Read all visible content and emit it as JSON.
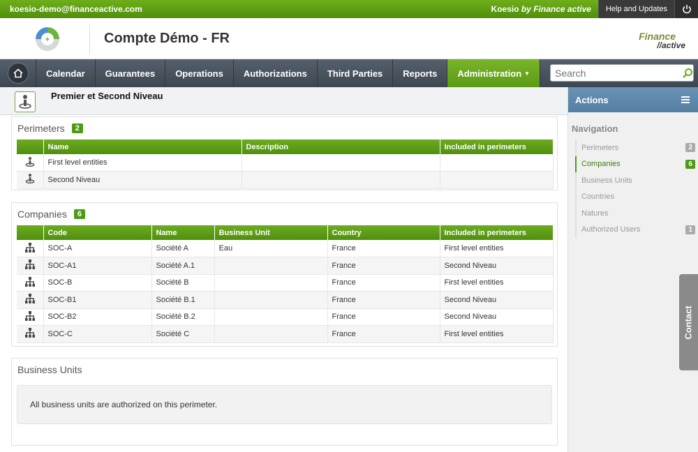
{
  "topbar": {
    "email": "koesio-demo@financeactive.com",
    "brand_prefix": "Koesio",
    "brand_suffix": "by Finance active",
    "help": "Help and Updates"
  },
  "header": {
    "title": "Compte Démo - FR",
    "logo_line1": "Finance",
    "logo_line2": "//active"
  },
  "nav": {
    "items": [
      "Calendar",
      "Guarantees",
      "Operations",
      "Authorizations",
      "Third Parties",
      "Reports"
    ],
    "active": "Administration",
    "search_placeholder": "Search"
  },
  "page": {
    "title": "Premier et Second Niveau"
  },
  "perimeters": {
    "title": "Perimeters",
    "count": "2",
    "columns": [
      "Name",
      "Description",
      "Included in perimeters"
    ],
    "rows": [
      [
        "First level entities",
        "",
        ""
      ],
      [
        "Second Niveau",
        "",
        ""
      ]
    ]
  },
  "companies": {
    "title": "Companies",
    "count": "6",
    "columns": [
      "Code",
      "Name",
      "Business Unit",
      "Country",
      "Included in perimeters"
    ],
    "rows": [
      [
        "SOC-A",
        "Société A",
        "Eau",
        "France",
        "First level entities"
      ],
      [
        "SOC-A1",
        "Société A.1",
        "",
        "France",
        "Second Niveau"
      ],
      [
        "SOC-B",
        "Société B",
        "",
        "France",
        "First level entities"
      ],
      [
        "SOC-B1",
        "Société B.1",
        "",
        "France",
        "Second Niveau"
      ],
      [
        "SOC-B2",
        "Société B.2",
        "",
        "France",
        "Second Niveau"
      ],
      [
        "SOC-C",
        "Société C",
        "",
        "France",
        "First level entities"
      ]
    ]
  },
  "business_units": {
    "title": "Business Units",
    "message": "All business units are authorized on this perimeter."
  },
  "sidebar": {
    "actions": "Actions",
    "navigation": "Navigation",
    "items": [
      {
        "label": "Perimeters",
        "badge": "2"
      },
      {
        "label": "Companies",
        "badge": "6"
      },
      {
        "label": "Business Units",
        "badge": ""
      },
      {
        "label": "Countries",
        "badge": ""
      },
      {
        "label": "Natures",
        "badge": ""
      },
      {
        "label": "Authorized Users",
        "badge": "1"
      }
    ],
    "active_index": 1
  },
  "contact": "Contact",
  "colors": {
    "green": "#4e9a14",
    "nav": "#48535d",
    "actions_blue": "#6a93b5"
  }
}
